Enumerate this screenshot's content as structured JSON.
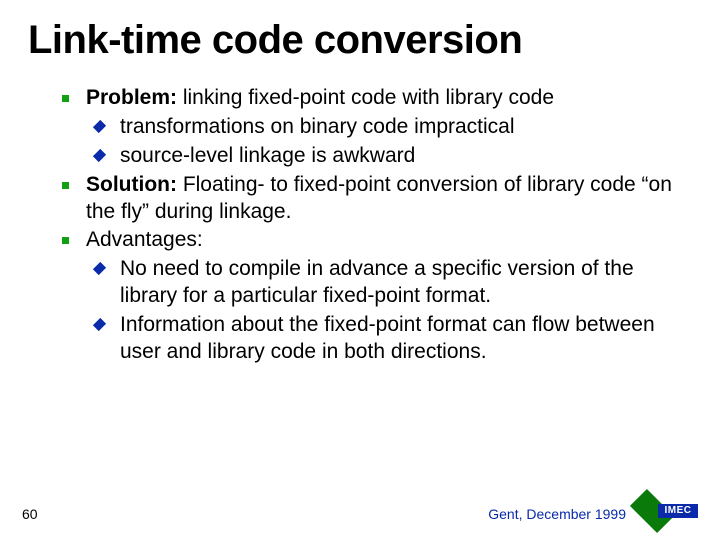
{
  "title": "Link-time code conversion",
  "bullets": {
    "b1_lead": "Problem:",
    "b1_rest": " linking fixed-point code with library code",
    "b1a": "transformations on binary code impractical",
    "b1b": "source-level linkage is awkward",
    "b2_lead": "Solution:",
    "b2_rest": "  Floating- to fixed-point conversion of library code “on the fly” during linkage.",
    "b3": "Advantages:",
    "b3a": "No need to compile in advance a specific version of the library for a particular fixed-point format.",
    "b3b": "Information about the fixed-point format can flow between user and library code in both directions."
  },
  "footer": {
    "page": "60",
    "venue": "Gent, December 1999",
    "logo_text": "IMEC"
  }
}
